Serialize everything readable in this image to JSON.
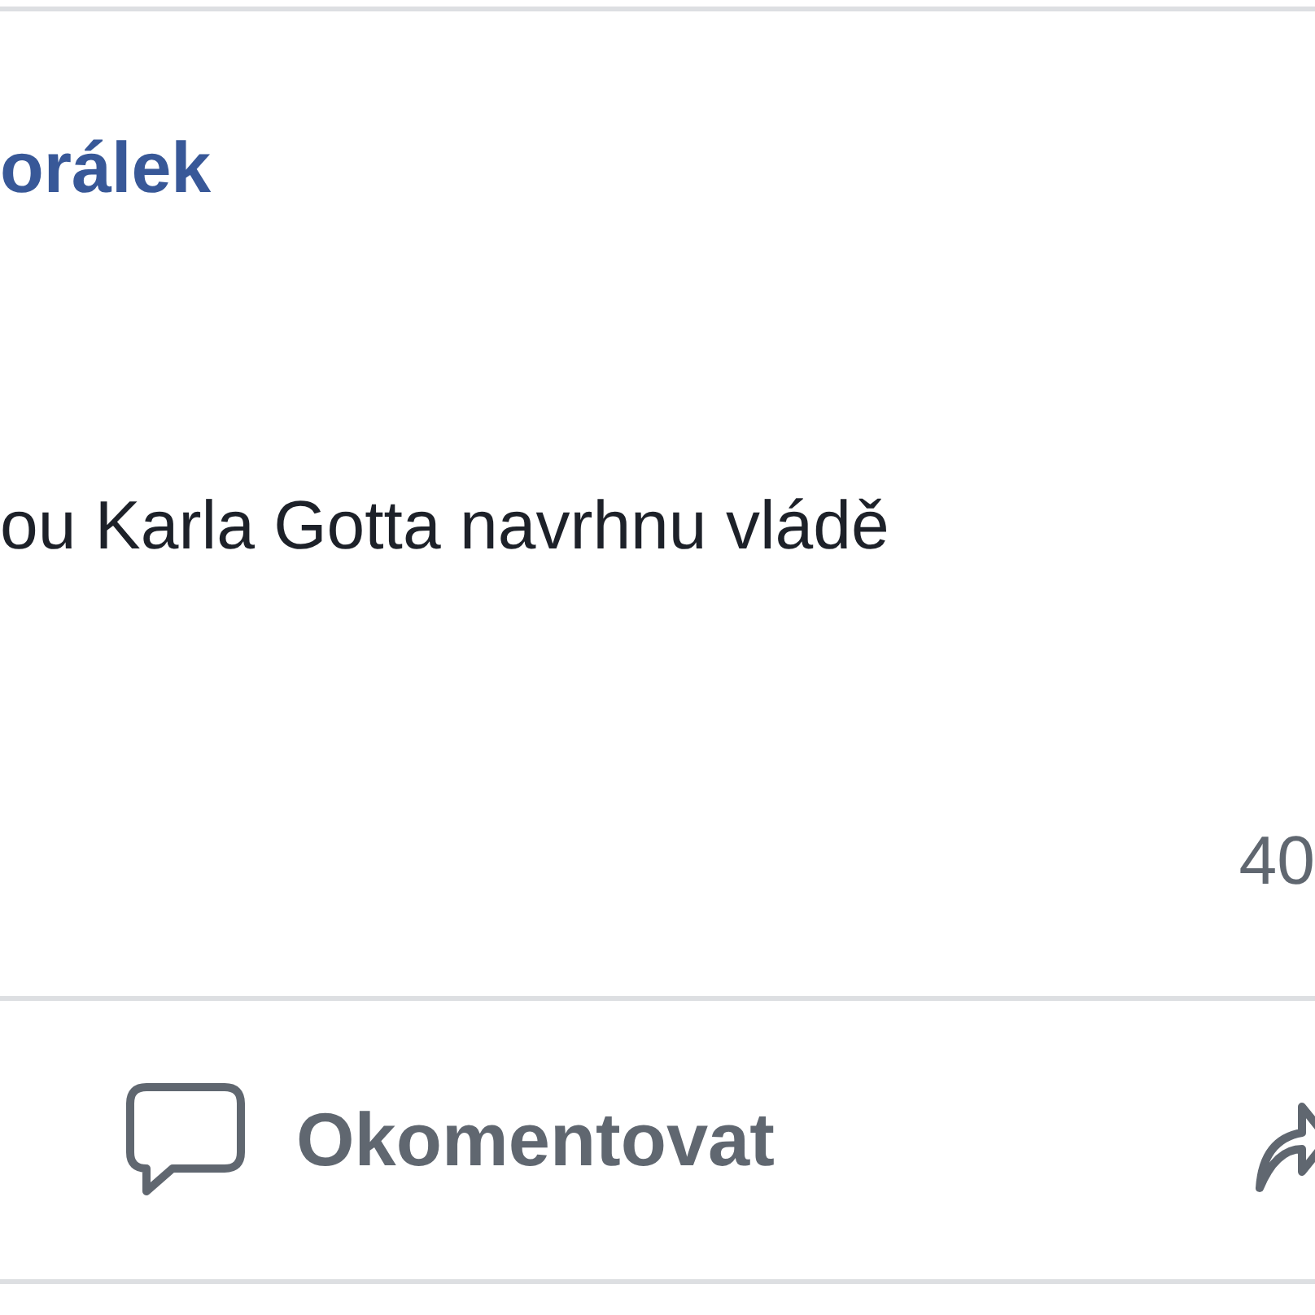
{
  "post": {
    "author": "orálek",
    "text": "ou Karla Gotta navrhnu vládě",
    "comment_count": "40"
  },
  "actions": [
    {
      "kind": "comment",
      "label": "Okomentovat"
    },
    {
      "kind": "share"
    }
  ]
}
